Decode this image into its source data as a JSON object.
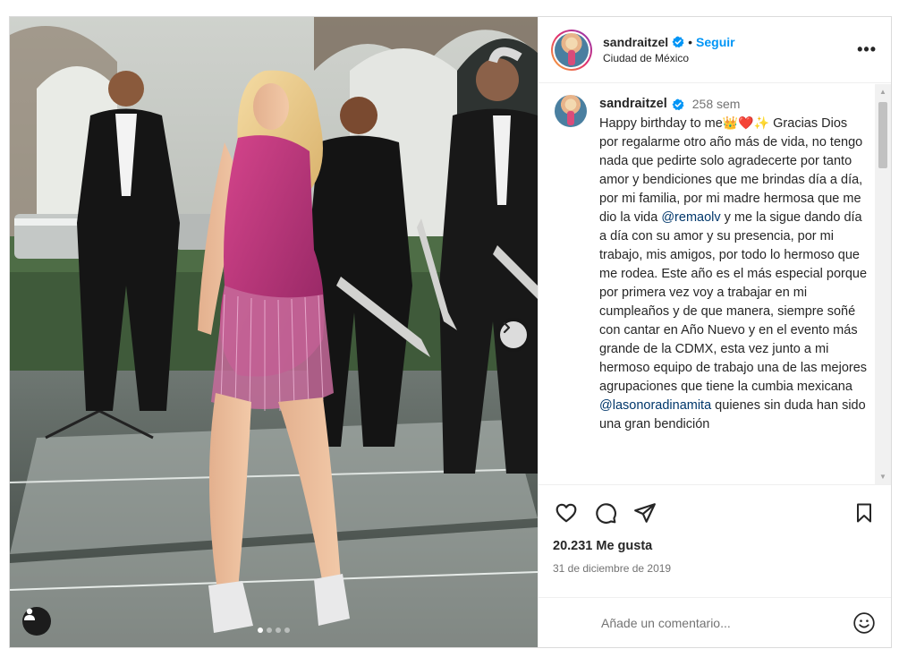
{
  "post": {
    "username": "sandraitzel",
    "follow_label": "Seguir",
    "separator": "•",
    "location": "Ciudad de México",
    "more_label": "•••"
  },
  "caption": {
    "username": "sandraitzel",
    "time": "258 sem",
    "text_part1": "Happy birthday to me",
    "emojis": "👑❤️✨",
    "text_part2": " Gracias Dios por regalarme otro año más de vida, no tengo nada que pedirte solo agradecerte por tanto amor y bendiciones que me brindas día a día, por mi familia, por mi madre hermosa que me dio la vida ",
    "mention1": "@remaolv",
    "text_part3": " y me la sigue dando día a día con su amor y su presencia, por mi trabajo, mis amigos, por todo lo hermoso que me rodea. Este año es el más especial porque por primera vez voy a trabajar en mi cumpleaños y de que manera, siempre soñé con cantar en Año Nuevo y en el evento más grande de la CDMX, esta vez junto a mi hermoso equipo de trabajo una de las mejores agrupaciones que tiene la cumbia mexicana ",
    "mention2": "@lasonoradinamita",
    "text_part4": " quienes sin duda han sido una gran bendición"
  },
  "icons": {
    "like": "heart-icon",
    "comment": "comment-bubble-icon",
    "share": "send-icon",
    "save": "bookmark-icon",
    "verified": "verified-badge-icon",
    "next": "chevron-right-icon",
    "tag": "user-tag-icon",
    "emoji": "smiley-icon"
  },
  "stats": {
    "likes": "20.231 Me gusta",
    "date": "31 de diciembre de 2019"
  },
  "comment": {
    "placeholder": "Añade un comentario..."
  },
  "carousel": {
    "slide_count": 4,
    "active_index": 0
  },
  "colors": {
    "accent": "#0095f6",
    "mention": "#00376b",
    "muted": "#737373"
  }
}
